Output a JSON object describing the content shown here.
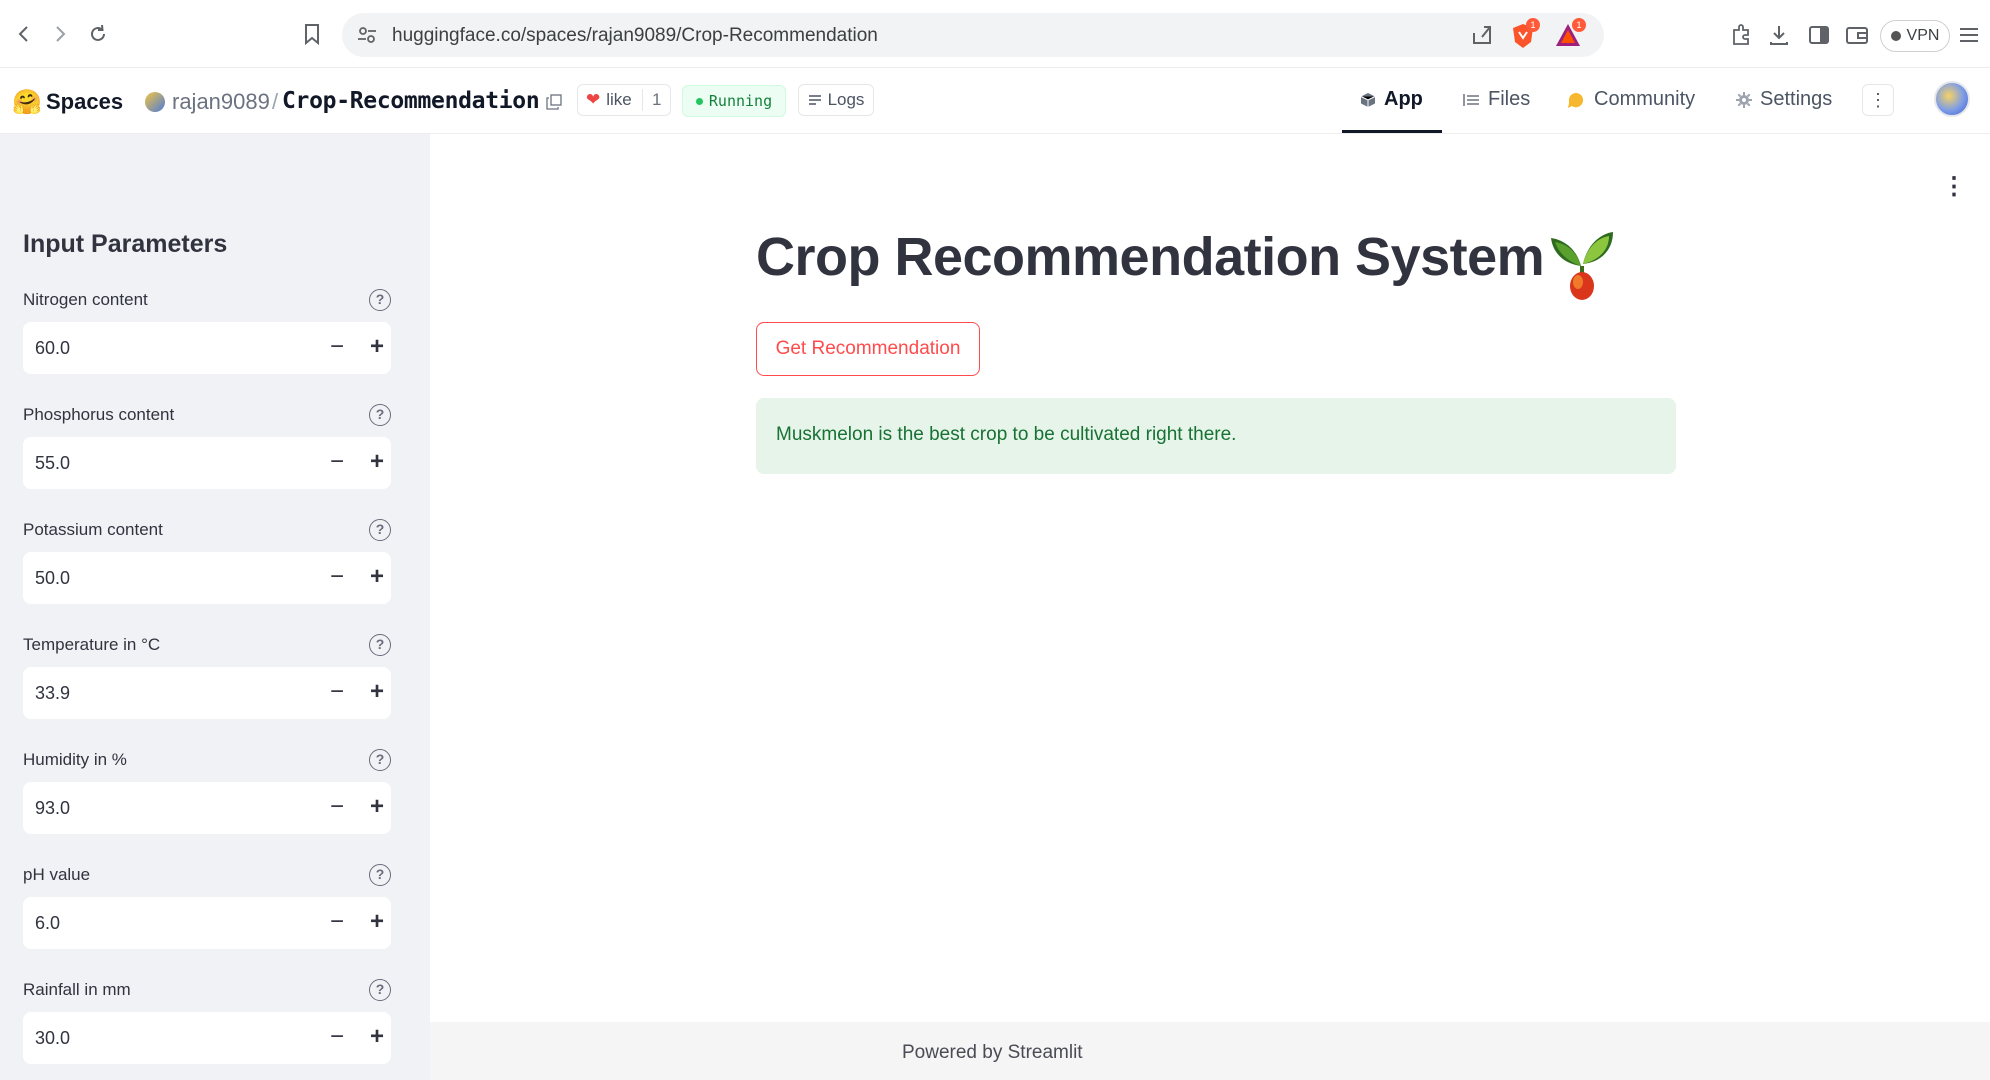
{
  "browser": {
    "url": "huggingface.co/spaces/rajan9089/Crop-Recommendation",
    "brave_badge": "1",
    "rewards_badge": "1",
    "vpn_label": "VPN"
  },
  "hf_header": {
    "logo_glyph": "🤗",
    "spaces_label": "Spaces",
    "owner": "rajan9089",
    "separator": "/",
    "repo": "Crop-Recommendation",
    "like_label": "like",
    "like_count": "1",
    "status": "Running",
    "logs_label": "Logs",
    "tabs": [
      {
        "label": "App",
        "icon": "cube-icon",
        "active": true
      },
      {
        "label": "Files",
        "icon": "files-icon",
        "active": false
      },
      {
        "label": "Community",
        "icon": "community-icon",
        "active": false
      },
      {
        "label": "Settings",
        "icon": "gear-icon",
        "active": false
      }
    ],
    "more_glyph": "⋮"
  },
  "sidebar": {
    "title": "Input Parameters",
    "params": [
      {
        "label": "Nitrogen content",
        "value": "60.0"
      },
      {
        "label": "Phosphorus content",
        "value": "55.0"
      },
      {
        "label": "Potassium content",
        "value": "50.0"
      },
      {
        "label": "Temperature in °C",
        "value": "33.9"
      },
      {
        "label": "Humidity in %",
        "value": "93.0"
      },
      {
        "label": "pH value",
        "value": "6.0"
      },
      {
        "label": "Rainfall in mm",
        "value": "30.0"
      }
    ],
    "help_glyph": "?",
    "minus_glyph": "−",
    "plus_glyph": "+"
  },
  "main": {
    "menu_glyph": "⋮",
    "title": "Crop Recommendation System",
    "button_label": "Get Recommendation",
    "result_text": "Muskmelon is the best crop to be cultivated right there.",
    "footer": "Powered by Streamlit"
  },
  "colors": {
    "accent": "#ff4b4b",
    "success_bg": "#e6f4ea",
    "success_text": "#177233",
    "sidebar_bg": "#f0f2f6"
  }
}
